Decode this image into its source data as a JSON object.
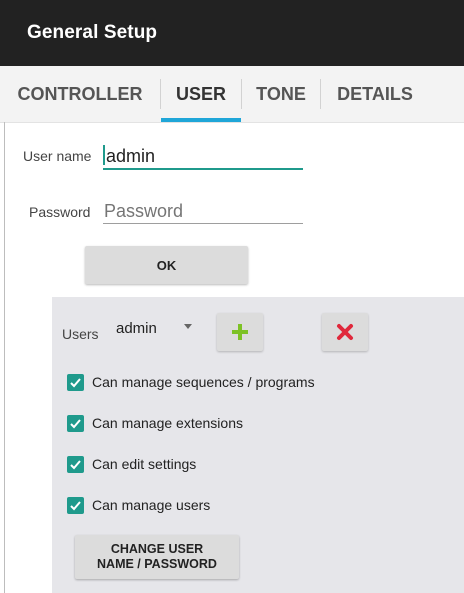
{
  "titlebar": {
    "title": "General Setup"
  },
  "tabs": [
    {
      "label": "CONTROLLER"
    },
    {
      "label": "USER"
    },
    {
      "label": "TONE"
    },
    {
      "label": "DETAILS"
    }
  ],
  "form": {
    "username_label": "User name",
    "username_value": "admin",
    "password_label": "Password",
    "password_placeholder": "Password",
    "ok_label": "OK"
  },
  "users_panel": {
    "users_label": "Users",
    "selected_user": "admin",
    "add_icon": "plus-icon",
    "delete_icon": "close-icon",
    "permissions": [
      {
        "label": "Can manage sequences / programs",
        "checked": true
      },
      {
        "label": "Can manage extensions",
        "checked": true
      },
      {
        "label": "Can edit settings",
        "checked": true
      },
      {
        "label": "Can manage users",
        "checked": true
      }
    ],
    "change_button_line1": "CHANGE USER",
    "change_button_line2": "NAME / PASSWORD"
  },
  "colors": {
    "accent_tab": "#1fa6d8",
    "accent_teal": "#1f9a8c",
    "add_green": "#7dc225",
    "delete_red": "#e0283b",
    "titlebar_bg": "#222222"
  }
}
